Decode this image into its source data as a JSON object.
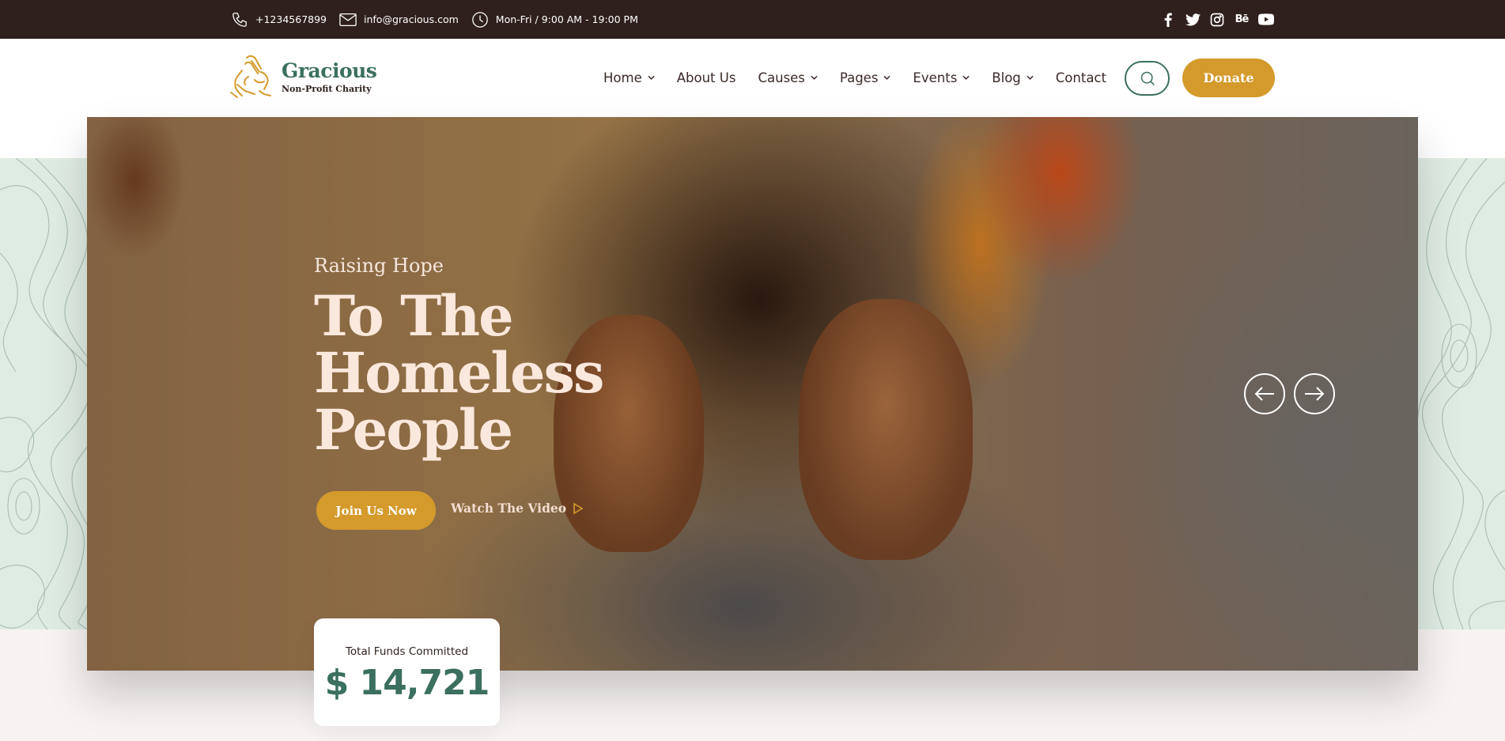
{
  "topbar": {
    "phone": "+1234567899",
    "email": "info@gracious.com",
    "hours": "Mon-Fri / 9:00 AM - 19:00 PM",
    "social": [
      "facebook-icon",
      "twitter-icon",
      "instagram-icon",
      "behance-icon",
      "youtube-icon"
    ],
    "behance_label": "Bē"
  },
  "logo": {
    "name": "Gracious",
    "tagline": "Non-Profit Charity"
  },
  "nav": {
    "items": [
      {
        "label": "Home",
        "dropdown": true
      },
      {
        "label": "About Us",
        "dropdown": false
      },
      {
        "label": "Causes",
        "dropdown": true
      },
      {
        "label": "Pages",
        "dropdown": true
      },
      {
        "label": "Events",
        "dropdown": true
      },
      {
        "label": "Blog",
        "dropdown": true
      },
      {
        "label": "Contact",
        "dropdown": false
      }
    ],
    "donate_label": "Donate"
  },
  "hero": {
    "kicker": "Raising Hope",
    "headline": "To The Homeless People",
    "join_label": "Join Us Now",
    "watch_label": "Watch The Video"
  },
  "funds": {
    "label": "Total Funds Committed",
    "amount": "$ 14,721"
  },
  "colors": {
    "brand_green": "#3b6f5f",
    "accent_gold": "#d49a2c",
    "topbar_bg": "#2f201d",
    "band_bg": "#dfece3"
  }
}
